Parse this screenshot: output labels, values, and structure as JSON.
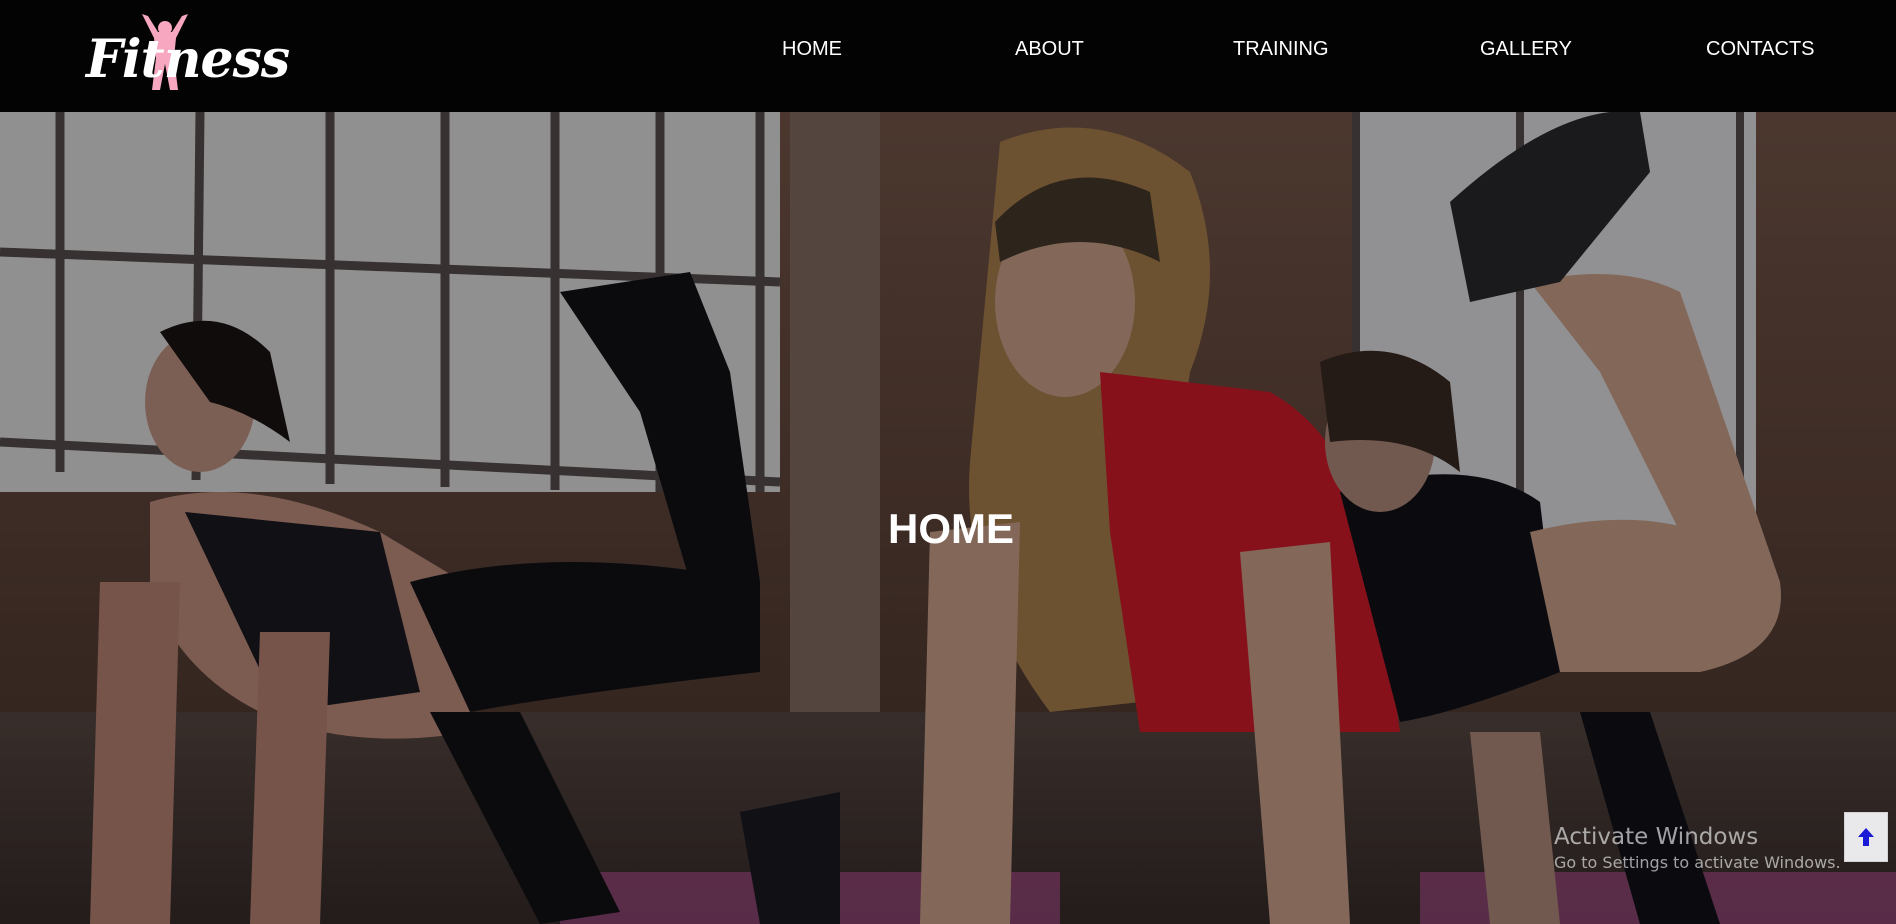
{
  "logo": {
    "text": "Fitness",
    "accent_color": "#f7a7c0"
  },
  "nav": {
    "items": [
      {
        "label": "HOME"
      },
      {
        "label": "ABOUT"
      },
      {
        "label": "TRAINING"
      },
      {
        "label": "GALLERY"
      },
      {
        "label": "CONTACTS"
      }
    ]
  },
  "hero": {
    "title": "HOME"
  },
  "watermark": {
    "title": "Activate Windows",
    "subtitle": "Go to Settings to activate Windows."
  },
  "back_to_top": {
    "icon": "arrow-up-icon",
    "color": "#1a1ad6"
  }
}
